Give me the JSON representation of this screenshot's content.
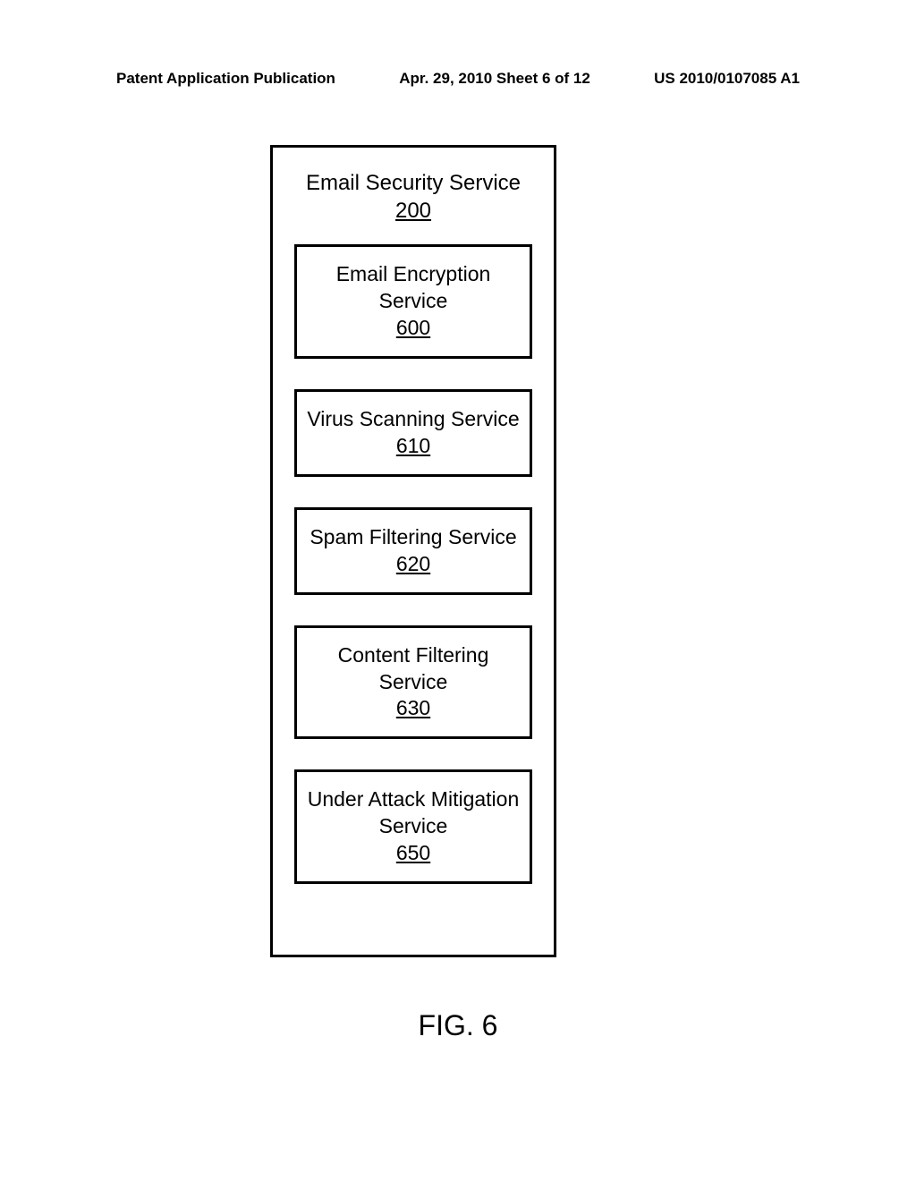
{
  "header": {
    "left": "Patent Application Publication",
    "center": "Apr. 29, 2010  Sheet 6 of 12",
    "right": "US 2010/0107085 A1"
  },
  "outerBox": {
    "title": "Email Security Service",
    "number": "200"
  },
  "services": [
    {
      "title": "Email Encryption Service",
      "number": "600"
    },
    {
      "title": "Virus Scanning Service",
      "number": "610"
    },
    {
      "title": "Spam Filtering Service",
      "number": "620"
    },
    {
      "title": "Content Filtering Service",
      "number": "630"
    },
    {
      "title": "Under Attack Mitigation Service",
      "number": "650"
    }
  ],
  "figureLabel": "FIG. 6"
}
